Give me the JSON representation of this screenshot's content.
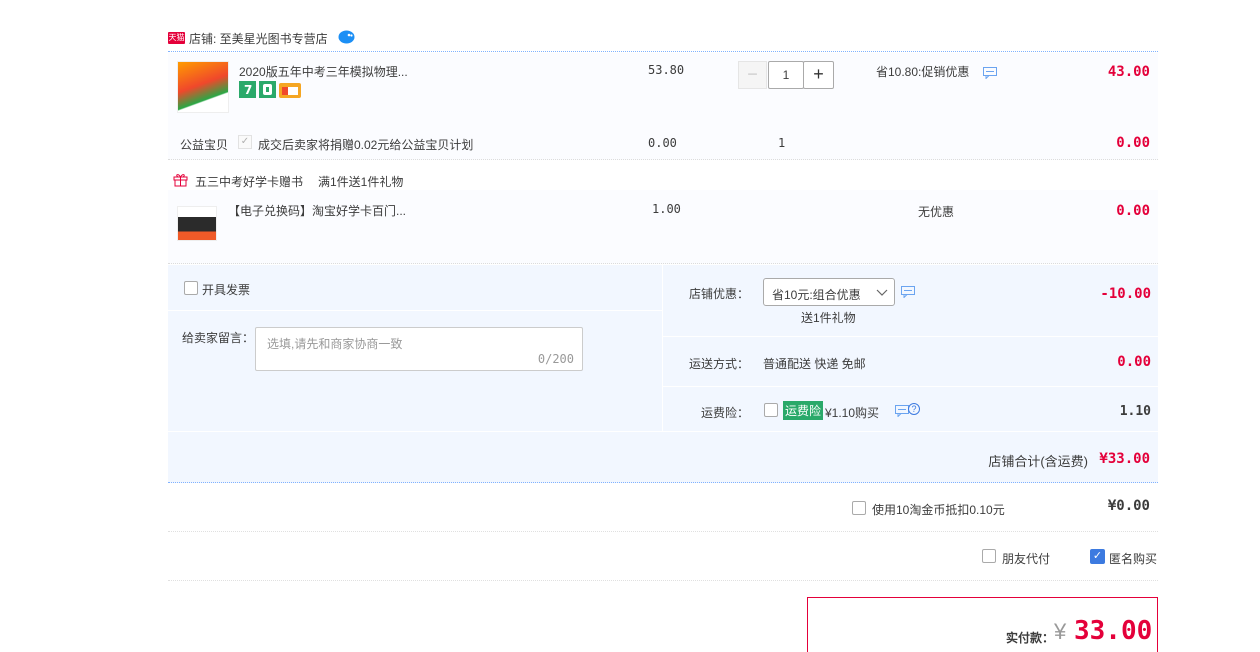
{
  "store": {
    "badge": "天猫",
    "label": "店铺: 至美星光图书专营店"
  },
  "item1": {
    "title": "2020版五年中考三年模拟物理...",
    "price": "53.80",
    "qty": "1",
    "minus": "−",
    "plus": "+",
    "promo": "省10.80:促销优惠",
    "total": "43.00"
  },
  "charity": {
    "label": "公益宝贝",
    "desc": "成交后卖家将捐赠0.02元给公益宝贝计划",
    "price": "0.00",
    "qty": "1",
    "total": "0.00"
  },
  "gift": {
    "label": "五三中考好学卡赠书",
    "rule": "满1件送1件礼物"
  },
  "item2": {
    "title": "【电子兑换码】淘宝好学卡百门...",
    "price": "1.00",
    "promo": "无优惠",
    "total": "0.00"
  },
  "invoice": {
    "label": "开具发票"
  },
  "message": {
    "label": "给卖家留言：",
    "placeholder": "选填,请先和商家协商一致",
    "count": "0/200"
  },
  "coupon": {
    "label": "店铺优惠：",
    "selected": "省10元:组合优惠",
    "gift_note": "送1件礼物",
    "amount": "-10.00"
  },
  "shipping": {
    "label": "运送方式：",
    "value": "普通配送 快递 免邮",
    "amount": "0.00"
  },
  "insurance": {
    "label": "运费险：",
    "badge": "运费险",
    "price": "¥1.10购买",
    "help": "?",
    "amount": "1.10"
  },
  "store_total": {
    "label": "店铺合计(含运费)",
    "amount": "¥33.00"
  },
  "coins": {
    "label": "使用10淘金币抵扣0.10元",
    "amount": "¥0.00"
  },
  "options": {
    "friend_pay": "朋友代付",
    "anonymous": "匿名购买",
    "anonymous_checked": true
  },
  "payment": {
    "label": "实付款：",
    "currency": "¥",
    "amount": "33.00"
  },
  "colors": {
    "accent_red": "#e4003a",
    "price_orange": "#f40",
    "link_blue": "#3c7ae0",
    "panel_bg": "#f2f7ff"
  }
}
